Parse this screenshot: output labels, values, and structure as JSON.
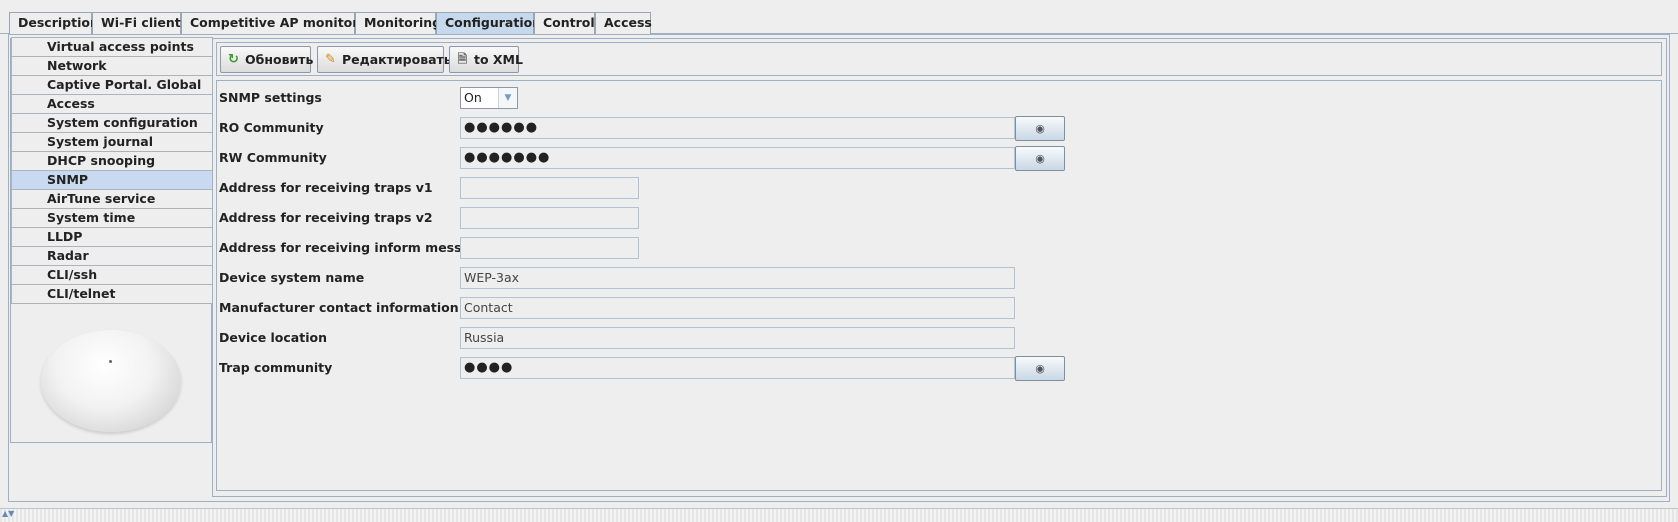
{
  "tabs": [
    "Description",
    "Wi-Fi clients",
    "Competitive AP monitoring",
    "Monitoring",
    "Configuration",
    "Control",
    "Access"
  ],
  "active_tab": "Configuration",
  "side_menu": [
    "Virtual access points",
    "Network",
    "Captive Portal. Global",
    "Access",
    "System configuration",
    "System journal",
    "DHCP snooping",
    "SNMP",
    "AirTune service",
    "System time",
    "LLDP",
    "Radar",
    "CLI/ssh",
    "CLI/telnet"
  ],
  "active_menu": "SNMP",
  "toolbar": {
    "refresh_label": "Обновить",
    "edit_label": "Редактировать",
    "xml_label": "to XML"
  },
  "form": {
    "snmp_settings": {
      "label": "SNMP settings",
      "value": "On"
    },
    "ro_community": {
      "label": "RO Community",
      "value": "●●●●●●"
    },
    "rw_community": {
      "label": "RW Community",
      "value": "●●●●●●●"
    },
    "traps_v1": {
      "label": "Address for receiving traps v1",
      "value": ""
    },
    "traps_v2": {
      "label": "Address for receiving traps v2",
      "value": ""
    },
    "inform": {
      "label": "Address for receiving inform messages",
      "value": ""
    },
    "system_name": {
      "label": "Device system name",
      "value": "WEP-3ax"
    },
    "contact": {
      "label": "Manufacturer contact information",
      "value": "Contact"
    },
    "location": {
      "label": "Device location",
      "value": "Russia"
    },
    "trap_community": {
      "label": "Trap community",
      "value": "●●●●"
    }
  },
  "icons": {
    "refresh": "refresh-icon",
    "edit": "pencil-icon",
    "xml": "document-icon",
    "show": "eye-icon",
    "dropdown": "chevron-down-icon"
  },
  "colors": {
    "active_tab": "#c6d8ec",
    "active_menu": "#c9daf0",
    "border": "#9fb0c4"
  }
}
